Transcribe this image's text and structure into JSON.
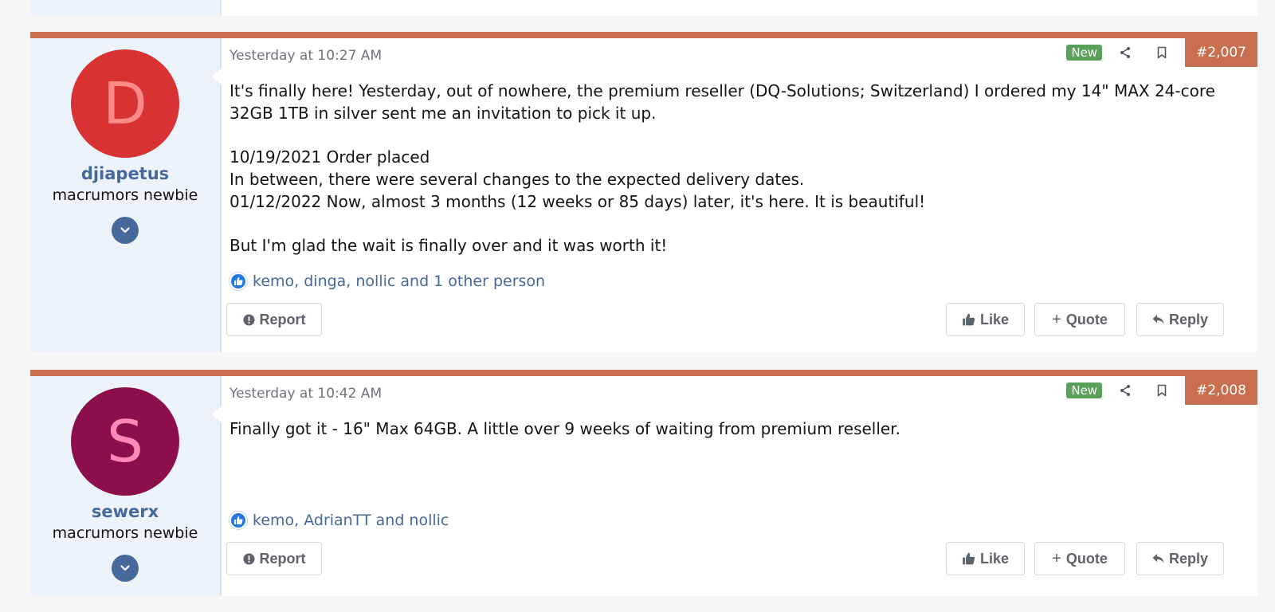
{
  "posts": [
    {
      "avatar_letter": "D",
      "avatar_bg": "#d93232",
      "avatar_fg": "#ff8a8a",
      "username": "djiapetus",
      "user_title": "macrumors newbie",
      "date": "Yesterday at 10:27 AM",
      "new_badge": "New",
      "post_number": "#2,007",
      "paragraphs": [
        "It's finally here! Yesterday, out of nowhere, the premium reseller (DQ-Solutions; Switzerland) I ordered my 14\" MAX 24-core 32GB 1TB in silver sent me an invitation to pick it up.",
        "10/19/2021 Order placed\nIn between, there were several changes to the expected delivery dates.\n01/12/2022 Now, almost 3 months (12 weeks or 85 days) later, it's here. It is beautiful!",
        "But I'm glad the wait is finally over and it was worth it!"
      ],
      "reactions": "kemo, dinga, nollic and 1 other person",
      "buttons": {
        "report": "Report",
        "like": "Like",
        "quote": "Quote",
        "reply": "Reply"
      }
    },
    {
      "avatar_letter": "S",
      "avatar_bg": "#8c0f4b",
      "avatar_fg": "#ff8ab8",
      "username": "sewerx",
      "user_title": "macrumors newbie",
      "date": "Yesterday at 10:42 AM",
      "new_badge": "New",
      "post_number": "#2,008",
      "paragraphs": [
        "Finally got it - 16\" Max 64GB. A little over 9 weeks of waiting from premium reseller."
      ],
      "reactions": "kemo, AdrianTT and nollic",
      "buttons": {
        "report": "Report",
        "like": "Like",
        "quote": "Quote",
        "reply": "Reply"
      }
    }
  ],
  "icons": {
    "share": "share-icon",
    "bookmark": "bookmark-icon",
    "expand": "chevron-down-icon",
    "like": "thumbs-up-icon",
    "report": "exclamation-circle-icon",
    "reply": "reply-arrow-icon"
  }
}
